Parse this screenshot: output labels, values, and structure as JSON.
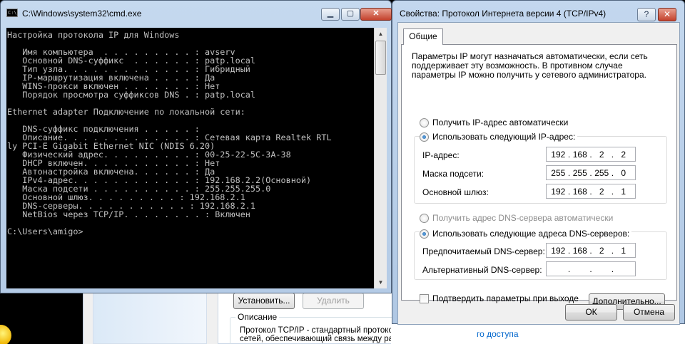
{
  "cmd": {
    "title": "C:\\Windows\\system32\\cmd.exe",
    "icon": "C:\\",
    "lines": [
      "Настройка протокола IP для Windows",
      "",
      "   Имя компьютера  . . . . . . . . . : avserv",
      "   Основной DNS-суффикс  . . . . . . : patp.local",
      "   Тип узла. . . . . . . . . . . . . : Гибридный",
      "   IP-маршрутизация включена . . . . : Да",
      "   WINS-прокси включен . . . . . . . : Нет",
      "   Порядок просмотра суффиксов DNS . : patp.local",
      "",
      "Ethernet adapter Подключение по локальной сети:",
      "",
      "   DNS-суффикс подключения . . . . . :",
      "   Описание. . . . . . . . . . . . . : Сетевая карта Realtek RTL",
      "ly PCI-E Gigabit Ethernet NIC (NDIS 6.20)",
      "   Физический адрес. . . . . . . . . : 00-25-22-5C-3A-38",
      "   DHCP включен. . . . . . . . . . . : Нет",
      "   Автонастройка включена. . . . . . : Да",
      "   IPv4-адрес. . . . . . . . . . . . : 192.168.2.2(Основной)",
      "   Маска подсети . . . . . . . . . . : 255.255.255.0",
      "   Основной шлюз. . . . . . . . . : 192.168.2.1",
      "   DNS-серверы. . . . . . . . . . . : 192.168.2.1",
      "   NetBios через TCP/IP. . . . . . . . : Включен",
      "",
      "C:\\Users\\amigo>"
    ]
  },
  "dialog": {
    "title": "Свойства: Протокол Интернета версии 4 (TCP/IPv4)",
    "help_button": "?",
    "close_button": "✕",
    "tab_general": "Общие",
    "intro": "Параметры IP могут назначаться автоматически, если сеть поддерживает эту возможность. В противном случае параметры IP можно получить у сетевого администратора.",
    "radio_ip_auto": "Получить IP-адрес автоматически",
    "radio_ip_manual": "Использовать следующий IP-адрес:",
    "ip_label": "IP-адрес:",
    "ip_value": [
      "192",
      "168",
      "2",
      "2"
    ],
    "mask_label": "Маска подсети:",
    "mask_value": [
      "255",
      "255",
      "255",
      "0"
    ],
    "gateway_label": "Основной шлюз:",
    "gateway_value": [
      "192",
      "168",
      "2",
      "1"
    ],
    "radio_dns_auto": "Получить адрес DNS-сервера автоматически",
    "radio_dns_manual": "Использовать следующие адреса DNS-серверов:",
    "dns_pref_label": "Предпочитаемый DNS-сервер:",
    "dns_pref_value": [
      "192",
      "168",
      "2",
      "1"
    ],
    "dns_alt_label": "Альтернативный DNS-сервер:",
    "dns_alt_value": [
      "",
      "",
      "",
      ""
    ],
    "confirm_on_exit": "Подтвердить параметры при выходе",
    "advanced_button": "Дополнительно...",
    "ok_button": "ОК",
    "cancel_button": "Отмена"
  },
  "background": {
    "install_button": "Установить...",
    "remove_button": "Удалить",
    "description_label": "Описание",
    "description_lines": [
      "Протокол TCP/IP - стандартный протокол глобальных",
      "сетей, обеспечивающий связь между различными"
    ],
    "link_fragment": "го доступа"
  }
}
